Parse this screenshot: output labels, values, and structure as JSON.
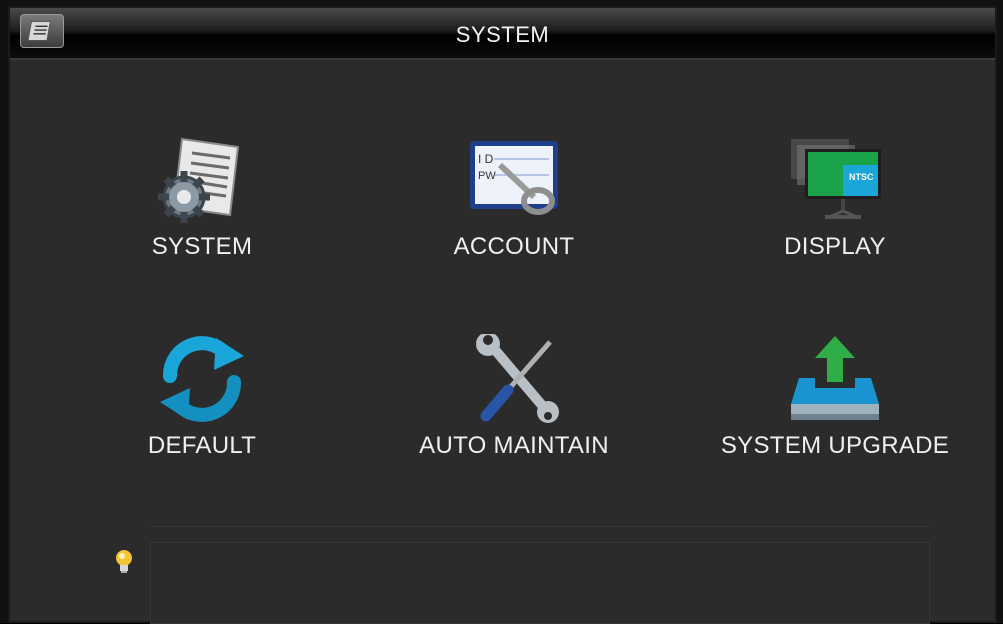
{
  "window": {
    "title": "SYSTEM",
    "app_icon": "system-menu-icon"
  },
  "menu": {
    "items": [
      {
        "label": "SYSTEM",
        "icon": "settings-document-icon"
      },
      {
        "label": "ACCOUNT",
        "icon": "id-password-key-icon"
      },
      {
        "label": "DISPLAY",
        "icon": "monitor-ntsc-icon"
      },
      {
        "label": "DEFAULT",
        "icon": "refresh-icon"
      },
      {
        "label": "AUTO MAINTAIN",
        "icon": "wrench-screwdriver-icon"
      },
      {
        "label": "SYSTEM UPGRADE",
        "icon": "upload-tray-icon"
      }
    ]
  },
  "tip": {
    "icon": "lightbulb-icon",
    "text": ""
  },
  "colors": {
    "background": "#2b2b2b",
    "text": "#f0f0f0",
    "accent_blue": "#1aa6d8",
    "accent_green": "#3ab54a"
  }
}
